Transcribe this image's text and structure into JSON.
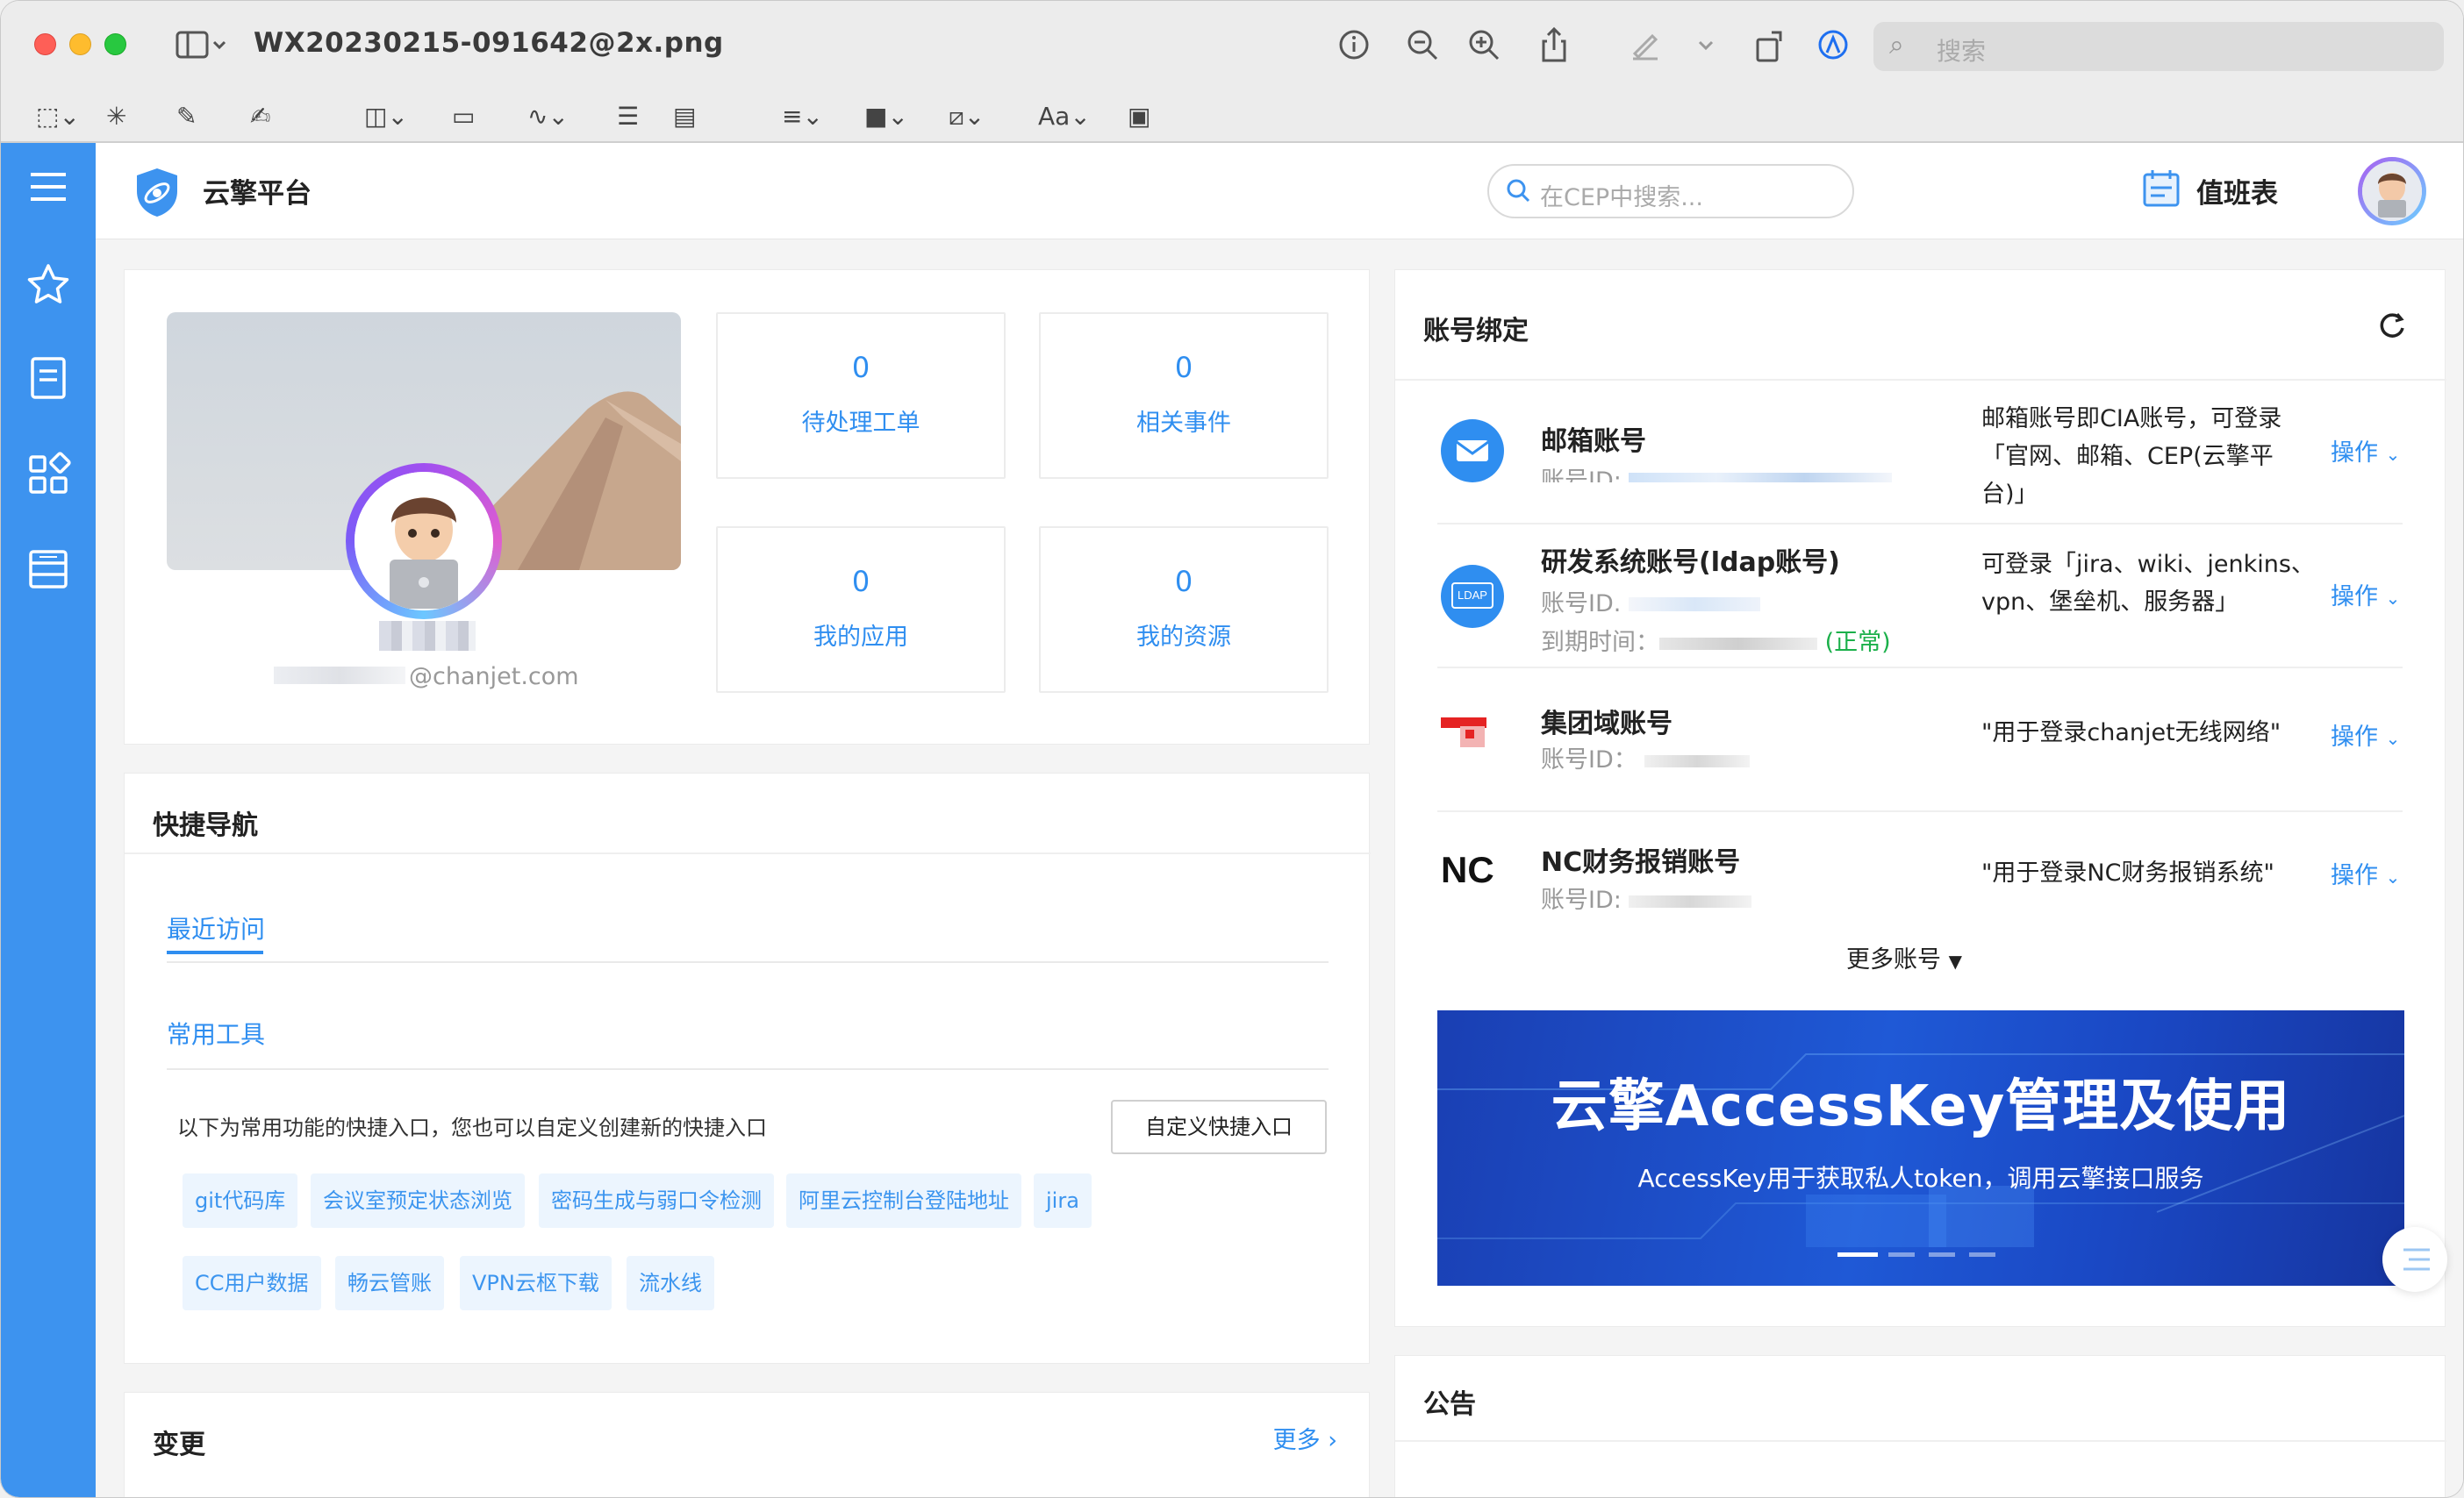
{
  "window": {
    "title": "WX20230215-091642@2x.png"
  },
  "toolbar": {
    "search_placeholder": "搜索",
    "font_label": "Aa"
  },
  "header": {
    "brand": "云擎平台",
    "search_placeholder": "在CEP中搜索...",
    "duty_label": "值班表"
  },
  "profile": {
    "email_visible": "@chanjet.com",
    "stats": [
      {
        "value": "0",
        "label": "待处理工单"
      },
      {
        "value": "0",
        "label": "相关事件"
      },
      {
        "value": "0",
        "label": "我的应用"
      },
      {
        "value": "0",
        "label": "我的资源"
      }
    ]
  },
  "quick_nav": {
    "title": "快捷导航",
    "tab_recent": "最近访问",
    "tab_tools": "常用工具",
    "description": "以下为常用功能的快捷入口，您也可以自定义创建新的快捷入口",
    "custom_button": "自定义快捷入口",
    "chips": [
      "git代码库",
      "会议室预定状态浏览",
      "密码生成与弱口令检测",
      "阿里云控制台登陆地址",
      "jira",
      "CC用户数据",
      "畅云管账",
      "VPN云枢下载",
      "流水线"
    ]
  },
  "changes": {
    "title": "变更",
    "more": "更多"
  },
  "accounts": {
    "title": "账号绑定",
    "items": [
      {
        "name": "邮箱账号",
        "sub": "账号ID:",
        "desc": "邮箱账号即CIA账号，可登录「官网、邮箱、CEP(云擎平台)」",
        "op": "操作"
      },
      {
        "name": "研发系统账号(ldap账号)",
        "sub": "账号ID.",
        "sub2": "到期时间：",
        "status": "(正常)",
        "badge": "LDAP",
        "desc": "可登录「jira、wiki、jenkins、vpn、堡垒机、服务器」",
        "op": "操作"
      },
      {
        "name": "集团域账号",
        "sub": "账号ID：",
        "desc": "\"用于登录chanjet无线网络\"",
        "op": "操作"
      },
      {
        "name": "NC财务报销账号",
        "sub": "账号ID:",
        "logo": "NC",
        "desc": "\"用于登录NC财务报销系统\"",
        "op": "操作"
      }
    ],
    "more": "更多账号",
    "banner": {
      "title": "云擎AccessKey管理及使用",
      "subtitle": "AccessKey用于获取私人token，调用云擎接口服务",
      "slides": 4,
      "active_slide": 1
    }
  },
  "notice": {
    "title": "公告"
  },
  "colors": {
    "sidebar": "#3d93ef",
    "accent": "#2f8ef0",
    "status_ok": "#1bb04a"
  }
}
